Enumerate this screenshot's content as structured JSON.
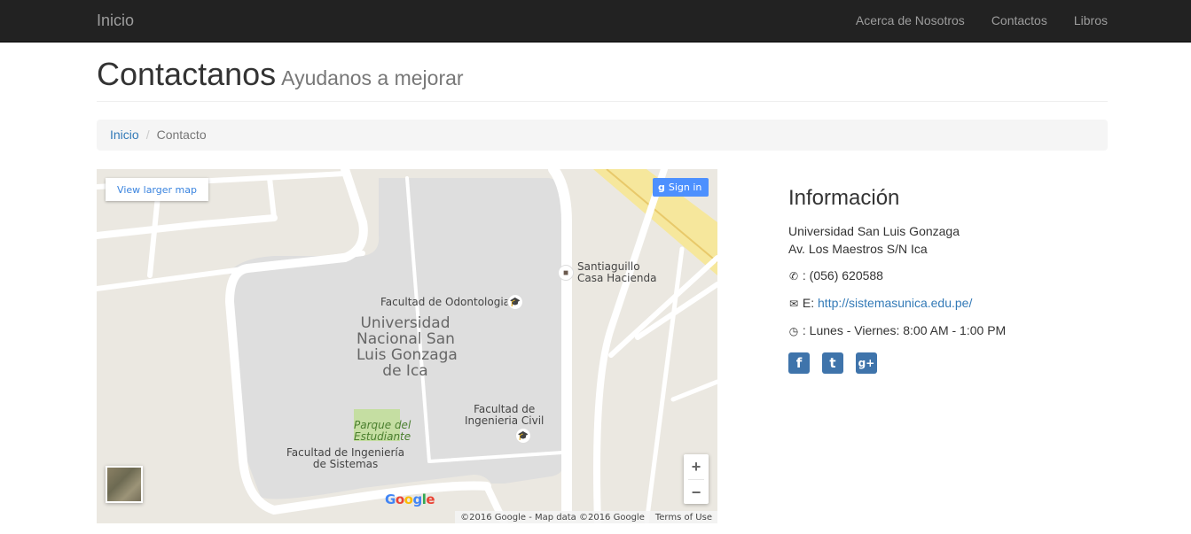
{
  "navbar": {
    "brand": "Inicio",
    "links": [
      "Acerca de Nosotros",
      "Contactos",
      "Libros"
    ]
  },
  "header": {
    "title": "Contactanos",
    "subtitle": "Ayudanos a mejorar"
  },
  "breadcrumb": {
    "home": "Inicio",
    "separator": "/",
    "current": "Contacto"
  },
  "map": {
    "view_larger": "View larger map",
    "sign_in": "Sign in",
    "labels": {
      "santiaguillo": "Santiaguillo\nCasa Hacienda",
      "odontologia": "Facultad de Odontologia",
      "university": "Universidad\nNacional San\nLuis Gonzaga\nde Ica",
      "civil": "Facultad de\nIngenieria Civil",
      "parque": "Parque del\nEstudiante",
      "sistemas": "Facultad de Ingeniería\nde Sistemas"
    },
    "zoom_in": "+",
    "zoom_out": "−",
    "google_logo": "Google",
    "copyright": "©2016 Google - Map data ©2016 Google",
    "terms": "Terms of Use"
  },
  "info": {
    "title": "Información",
    "line1": "Universidad San Luis Gonzaga",
    "line2": "Av. Los Maestros S/N Ica",
    "phone": " : (056) 620588",
    "email_prefix": " E: ",
    "email_link": "http://sistemasunica.edu.pe/",
    "hours": " : Lunes - Viernes: 8:00 AM - 1:00 PM"
  },
  "colors": {
    "navbar": "#222222",
    "link": "#337ab7",
    "social": "#3f74ab",
    "map_bg": "#ebe8e1",
    "campus": "#dedede",
    "park": "#c5dea2"
  }
}
